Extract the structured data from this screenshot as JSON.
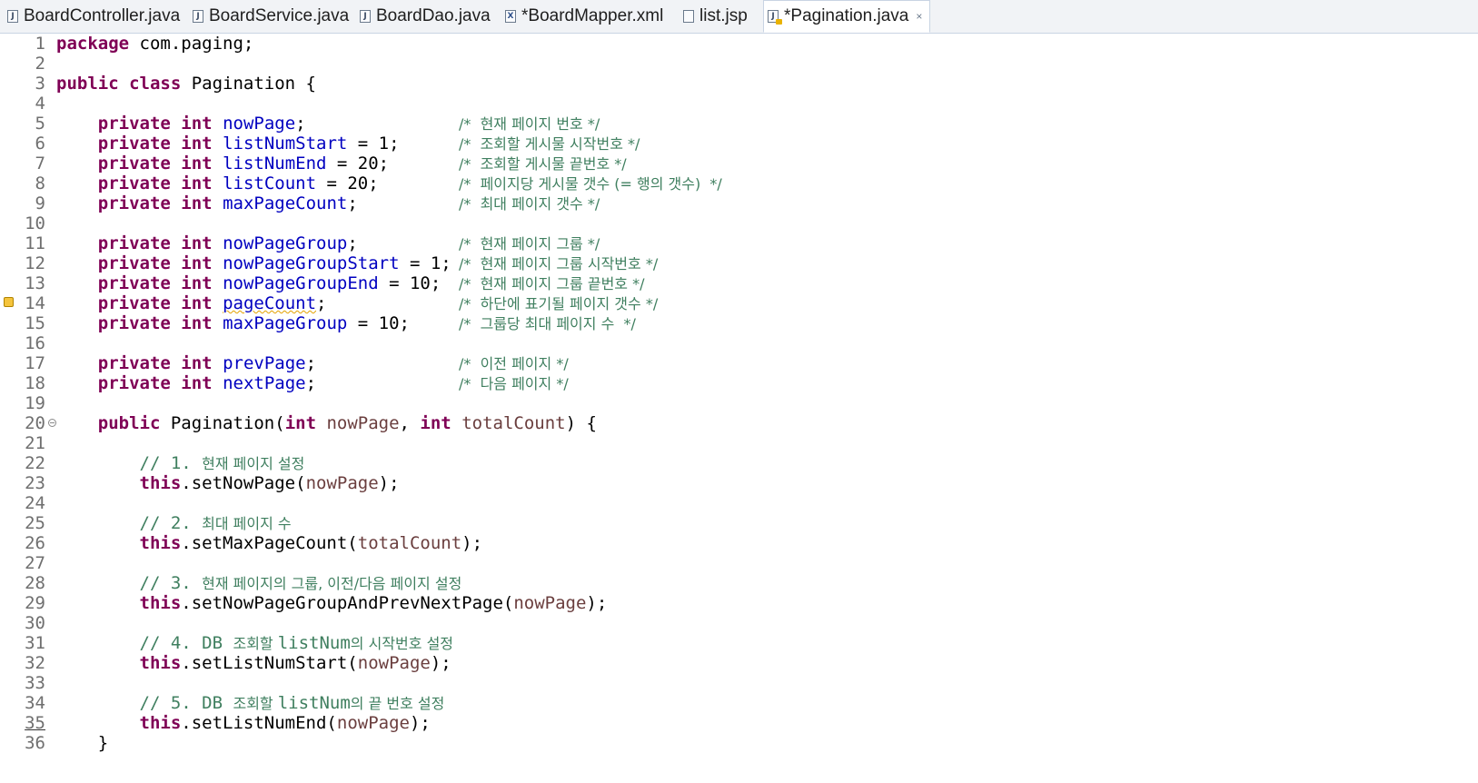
{
  "tabs": [
    {
      "label": "BoardController.java",
      "icon": "java-file-icon"
    },
    {
      "label": "BoardService.java",
      "icon": "java-file-icon"
    },
    {
      "label": "BoardDao.java",
      "icon": "java-file-icon"
    },
    {
      "label": "*BoardMapper.xml",
      "icon": "xml-file-icon"
    },
    {
      "label": "list.jsp",
      "icon": "jsp-file-icon"
    },
    {
      "label": "*Pagination.java",
      "icon": "java-file-warning-icon",
      "active": true,
      "close_symbol": "×"
    }
  ],
  "editor": {
    "lines": [
      {
        "n": "1"
      },
      {
        "n": "2"
      },
      {
        "n": "3"
      },
      {
        "n": "4"
      },
      {
        "n": "5"
      },
      {
        "n": "6"
      },
      {
        "n": "7"
      },
      {
        "n": "8"
      },
      {
        "n": "9"
      },
      {
        "n": "10"
      },
      {
        "n": "11"
      },
      {
        "n": "12"
      },
      {
        "n": "13"
      },
      {
        "n": "14"
      },
      {
        "n": "15"
      },
      {
        "n": "16"
      },
      {
        "n": "17"
      },
      {
        "n": "18"
      },
      {
        "n": "19"
      },
      {
        "n": "20"
      },
      {
        "n": "21"
      },
      {
        "n": "22"
      },
      {
        "n": "23"
      },
      {
        "n": "24"
      },
      {
        "n": "25"
      },
      {
        "n": "26"
      },
      {
        "n": "27"
      },
      {
        "n": "28"
      },
      {
        "n": "29"
      },
      {
        "n": "30"
      },
      {
        "n": "31"
      },
      {
        "n": "32"
      },
      {
        "n": "33"
      },
      {
        "n": "34"
      },
      {
        "n": "35"
      },
      {
        "n": "36"
      }
    ],
    "tokens": {
      "package": "package",
      "pkg_name": " com.paging;",
      "public": "public",
      "class": " class",
      "class_name": " Pagination {",
      "private": "private",
      "int": " int",
      "nowPage": "nowPage",
      "listNumStart": "listNumStart",
      "listNumEnd": "listNumEnd",
      "listCount": "listCount",
      "maxPageCount": "maxPageCount",
      "nowPageGroup": "nowPageGroup",
      "nowPageGroupStart": "nowPageGroupStart",
      "nowPageGroupEnd": "nowPageGroupEnd",
      "pageCount": "pageCount",
      "maxPageGroup": "maxPageGroup",
      "prevPage": "prevPage",
      "nextPage": "nextPage",
      "semi": ";",
      "eq1": " = 1;",
      "eq20": " = 20;",
      "eq10": " = 10;",
      "ctor_name": " Pagination(",
      "p_int": "int",
      "p_nowPage": " nowPage",
      "comma": ", ",
      "p_totalCount": " totalCount",
      "ctor_close": ") {",
      "this": "this",
      "setNowPage": ".setNowPage(",
      "setMaxPageCount": ".setMaxPageCount(",
      "setGroup": ".setNowPageGroupAndPrevNextPage(",
      "setListNumStart": ".setListNumStart(",
      "setListNumEnd": ".setListNumEnd(",
      "nowPage_arg": "nowPage",
      "totalCount_arg": "totalCount",
      "call_close": ");",
      "brace_close": "}"
    },
    "comments": {
      "c5": "/*  현재 페이지 번호 */",
      "c6": "/*  조회할 게시물 시작번호 */",
      "c7": "/*  조회할 게시물 끝번호 */",
      "c8": "/*  페이지당 게시물 갯수 (= 행의 갯수)  */",
      "c9": "/*  최대 페이지 갯수 */",
      "c11": "/*  현재 페이지 그룹 */",
      "c12": "/*  현재 페이지 그룹 시작번호 */",
      "c13": "/*  현재 페이지 그룹 끝번호 */",
      "c14": "/*  하단에 표기될 페이지 갯수 */",
      "c15": "/*  그룹당 최대 페이지 수  */",
      "c17": "/*  이전 페이지 */",
      "c18": "/*  다음 페이지 */",
      "c22a": "// 1. ",
      "c22b": "현재 페이지 설정",
      "c25a": "// 2. ",
      "c25b": "최대 페이지 수",
      "c28a": "// 3. ",
      "c28b": "현재 페이지의 그룹, 이전/다음 페이지 설정",
      "c31a": "// 4. DB ",
      "c31b": "조회할 ",
      "c31c": "listNum",
      "c31d": "의 시작번호 설정",
      "c34a": "// 5. DB ",
      "c34b": "조회할 ",
      "c34c": "listNum",
      "c34d": "의 끝 번호 설정"
    }
  },
  "colors": {
    "keyword": "#7f0055",
    "field": "#0000c0",
    "parameter": "#6a3e3e",
    "comment": "#3f7f5f"
  }
}
